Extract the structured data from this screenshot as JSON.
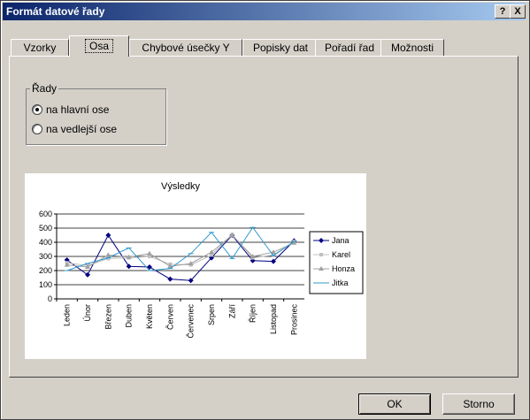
{
  "window": {
    "title": "Formát datové řady"
  },
  "titlebar_buttons": {
    "help": "?",
    "close": "X"
  },
  "tabs": [
    {
      "label": "Vzorky"
    },
    {
      "label": "Osa"
    },
    {
      "label": "Chybové úsečky Y"
    },
    {
      "label": "Popisky dat"
    },
    {
      "label": "Pořadí řad"
    },
    {
      "label": "Možnosti"
    }
  ],
  "active_tab": "Osa",
  "group": {
    "label": "Řady",
    "options": [
      {
        "label": "na hlavní ose",
        "checked": true
      },
      {
        "label": "na vedlejší ose",
        "checked": false
      }
    ]
  },
  "buttons": {
    "ok": "OK",
    "cancel": "Storno"
  },
  "chart_data": {
    "type": "line",
    "title": "Výsledky",
    "categories": [
      "Leden",
      "Únor",
      "Březen",
      "Duben",
      "Květen",
      "Červen",
      "Červenec",
      "Srpen",
      "Září",
      "Říjen",
      "Listopad",
      "Prosinec"
    ],
    "ylim": [
      0,
      600
    ],
    "yticks": [
      0,
      100,
      200,
      300,
      400,
      500,
      600
    ],
    "grid": true,
    "legend_position": "right",
    "series": [
      {
        "name": "Jana",
        "color": "#000080",
        "values": [
          275,
          170,
          450,
          230,
          225,
          140,
          130,
          290,
          450,
          270,
          265,
          410
        ]
      },
      {
        "name": "Karel",
        "color": "#c0c0c0",
        "values": [
          255,
          235,
          285,
          290,
          300,
          245,
          240,
          310,
          455,
          290,
          310,
          405
        ]
      },
      {
        "name": "Honza",
        "color": "#a0a0a0",
        "values": [
          240,
          225,
          310,
          295,
          320,
          230,
          250,
          330,
          450,
          300,
          330,
          395
        ]
      },
      {
        "name": "Jitka",
        "color": "#3399cc",
        "values": [
          200,
          250,
          290,
          360,
          200,
          215,
          320,
          470,
          285,
          505,
          305,
          405
        ]
      }
    ]
  }
}
